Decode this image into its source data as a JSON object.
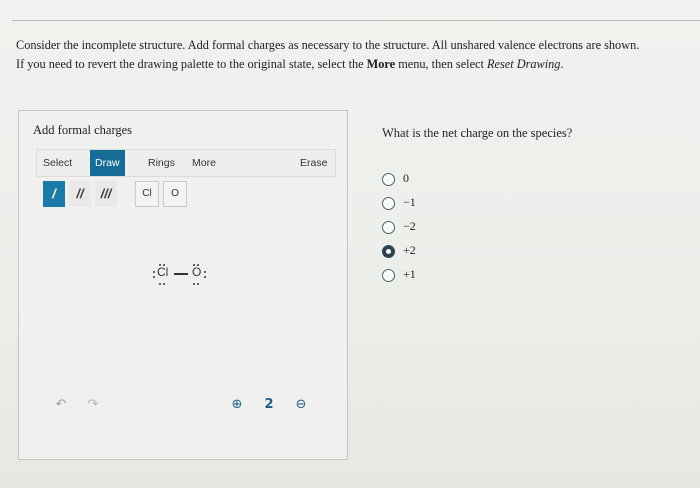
{
  "instructions": {
    "line1": "Consider the incomplete structure. Add formal charges as necessary to the structure. All unshared valence electrons are shown.",
    "line2_prefix": "If you need to revert the drawing palette to the original state, select the ",
    "line2_more": "More",
    "line2_middle": " menu, then select ",
    "line2_reset": "Reset Drawing",
    "line2_suffix": "."
  },
  "panel": {
    "title": "Add formal charges",
    "menu": {
      "select": "Select",
      "draw": "Draw",
      "rings": "Rings",
      "more": "More",
      "erase": "Erase",
      "active": "draw"
    },
    "tools": {
      "single_bond": "/",
      "double_bond": "//",
      "triple_bond": "///",
      "atom_cl": "Cl",
      "atom_o": "O"
    },
    "molecule": {
      "atom1": "Cl",
      "atom2": "O"
    },
    "controls": {
      "undo": "↶",
      "redo": "↷",
      "zoom_in": "⊕",
      "reset_zoom": "2",
      "zoom_out": "⊖"
    }
  },
  "question": {
    "text": "What is the net charge on the species?",
    "options": [
      "0",
      "−1",
      "−2",
      "+2",
      "+1"
    ],
    "selected_index": 3
  },
  "colors": {
    "accent": "#146c97",
    "radio": "#2b4454"
  }
}
